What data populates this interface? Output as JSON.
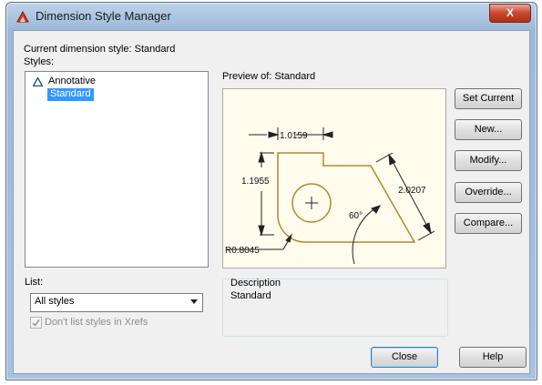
{
  "window": {
    "title": "Dimension Style Manager",
    "close_glyph": "X"
  },
  "current_style": "Current dimension style: Standard",
  "styles": {
    "label": "Styles:",
    "items": [
      {
        "label": "Annotative",
        "icon": "annotative-triangle-icon",
        "selected": false
      },
      {
        "label": "Standard",
        "selected": true
      }
    ]
  },
  "preview": {
    "label": "Preview of: Standard",
    "dim_top": "1.0159",
    "dim_left": "1.1955",
    "dim_diag": "2.0207",
    "dim_angle": "60°",
    "dim_radius": "R0.8045",
    "colors": {
      "line": "#b08a2a",
      "bg": "#fffcee"
    }
  },
  "description": {
    "label": "Description",
    "text": "Standard"
  },
  "list": {
    "label": "List:",
    "selected": "All styles",
    "checkbox_label": "Don't list styles in Xrefs",
    "checked": true
  },
  "buttons": {
    "set_current": "Set Current",
    "new": "New...",
    "modify": "Modify...",
    "override": "Override...",
    "compare": "Compare...",
    "close": "Close",
    "help": "Help"
  }
}
